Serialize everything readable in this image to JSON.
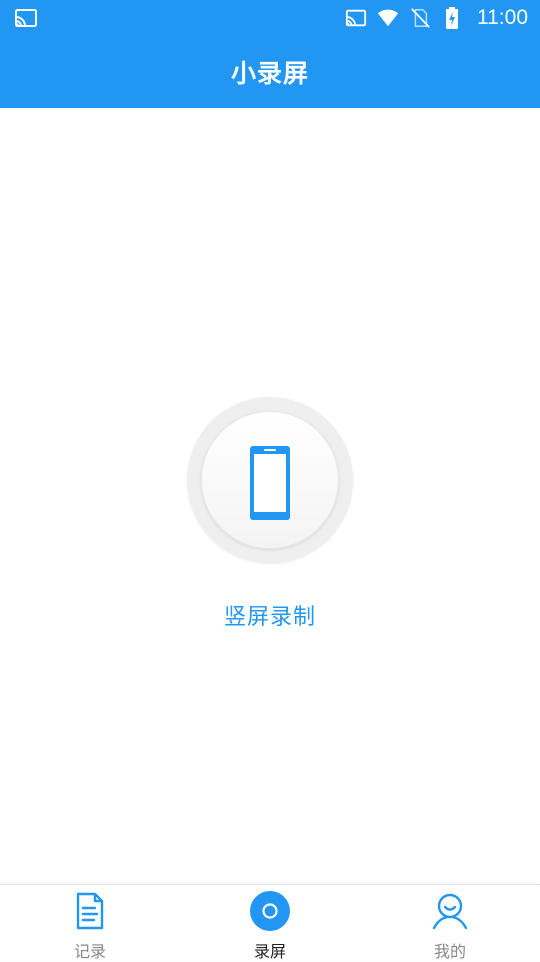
{
  "status_bar": {
    "time": "11:00",
    "left_icon": "cast-icon",
    "right_icons": [
      "cast-icon",
      "wifi-icon",
      "no-sim-icon",
      "battery-charging-icon"
    ]
  },
  "header": {
    "title": "小录屏"
  },
  "main": {
    "record_button_icon": "phone-portrait-icon",
    "record_label": "竖屏录制"
  },
  "bottom_nav": {
    "items": [
      {
        "label": "记录",
        "icon": "document-icon",
        "active": false
      },
      {
        "label": "录屏",
        "icon": "record-circle-icon",
        "active": true
      },
      {
        "label": "我的",
        "icon": "user-icon",
        "active": false
      }
    ]
  },
  "colors": {
    "primary": "#2196F3",
    "nav_inactive": "#888888",
    "nav_active_label": "#222222",
    "background": "#ffffff"
  }
}
